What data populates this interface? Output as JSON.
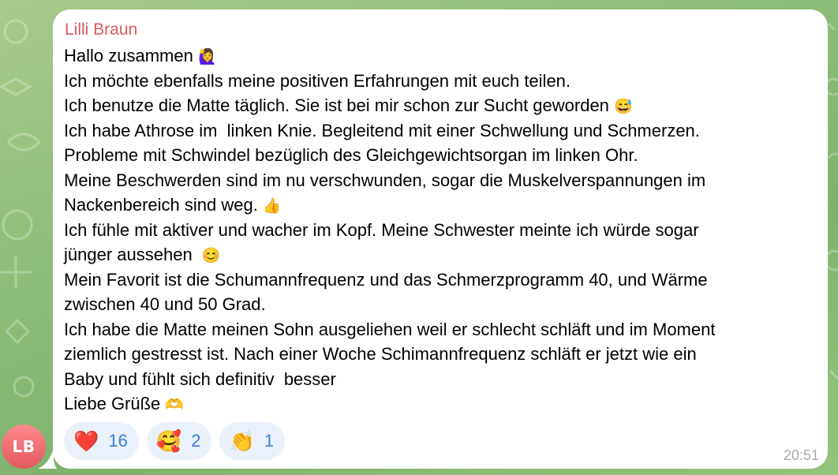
{
  "chat": {
    "avatar_initials": "LB",
    "sender": "Lilli Braun",
    "time": "20:51"
  },
  "message": {
    "lines": [
      {
        "text": "Hallo zusammen ",
        "emoji": "🙋‍♀️"
      },
      {
        "text": "Ich möchte ebenfalls meine positiven Erfahrungen mit euch teilen.",
        "emoji": ""
      },
      {
        "text": "Ich benutze die Matte täglich. Sie ist bei mir schon zur Sucht geworden ",
        "emoji": "😅"
      },
      {
        "text": "Ich habe Athrose im  linken Knie. Begleitend mit einer Schwellung und Schmerzen.",
        "emoji": ""
      },
      {
        "text": "Probleme mit Schwindel bezüglich des Gleichgewichtsorgan im linken Ohr.",
        "emoji": ""
      },
      {
        "text": "Meine Beschwerden sind im nu verschwunden, sogar die Muskelverspannungen im",
        "emoji": ""
      },
      {
        "text": "Nackenbereich sind weg. ",
        "emoji": "👍"
      },
      {
        "text": "Ich fühle mit aktiver und wacher im Kopf. Meine Schwester meinte ich würde sogar",
        "emoji": ""
      },
      {
        "text": "jünger aussehen  ",
        "emoji": "😊"
      },
      {
        "text": "Mein Favorit ist die Schumannfrequenz und das Schmerzprogramm 40, und Wärme",
        "emoji": ""
      },
      {
        "text": "zwischen 40 und 50 Grad.",
        "emoji": ""
      },
      {
        "text": "Ich habe die Matte meinen Sohn ausgeliehen weil er schlecht schläft und im Moment",
        "emoji": ""
      },
      {
        "text": "ziemlich gestresst ist. Nach einer Woche Schimannfrequenz schläft er jetzt wie ein",
        "emoji": ""
      },
      {
        "text": "Baby und fühlt sich definitiv  besser",
        "emoji": ""
      },
      {
        "text": "Liebe Grüße ",
        "emoji": "🫶"
      }
    ]
  },
  "reactions": [
    {
      "emoji": "❤️",
      "count": "16"
    },
    {
      "emoji": "🥰",
      "count": "2"
    },
    {
      "emoji": "👏",
      "count": "1"
    }
  ],
  "colors": {
    "sender": "#d85a5c",
    "reaction_count": "#3a7ed6",
    "reaction_bg": "#eaf1fb",
    "avatar": "#e8666b"
  }
}
